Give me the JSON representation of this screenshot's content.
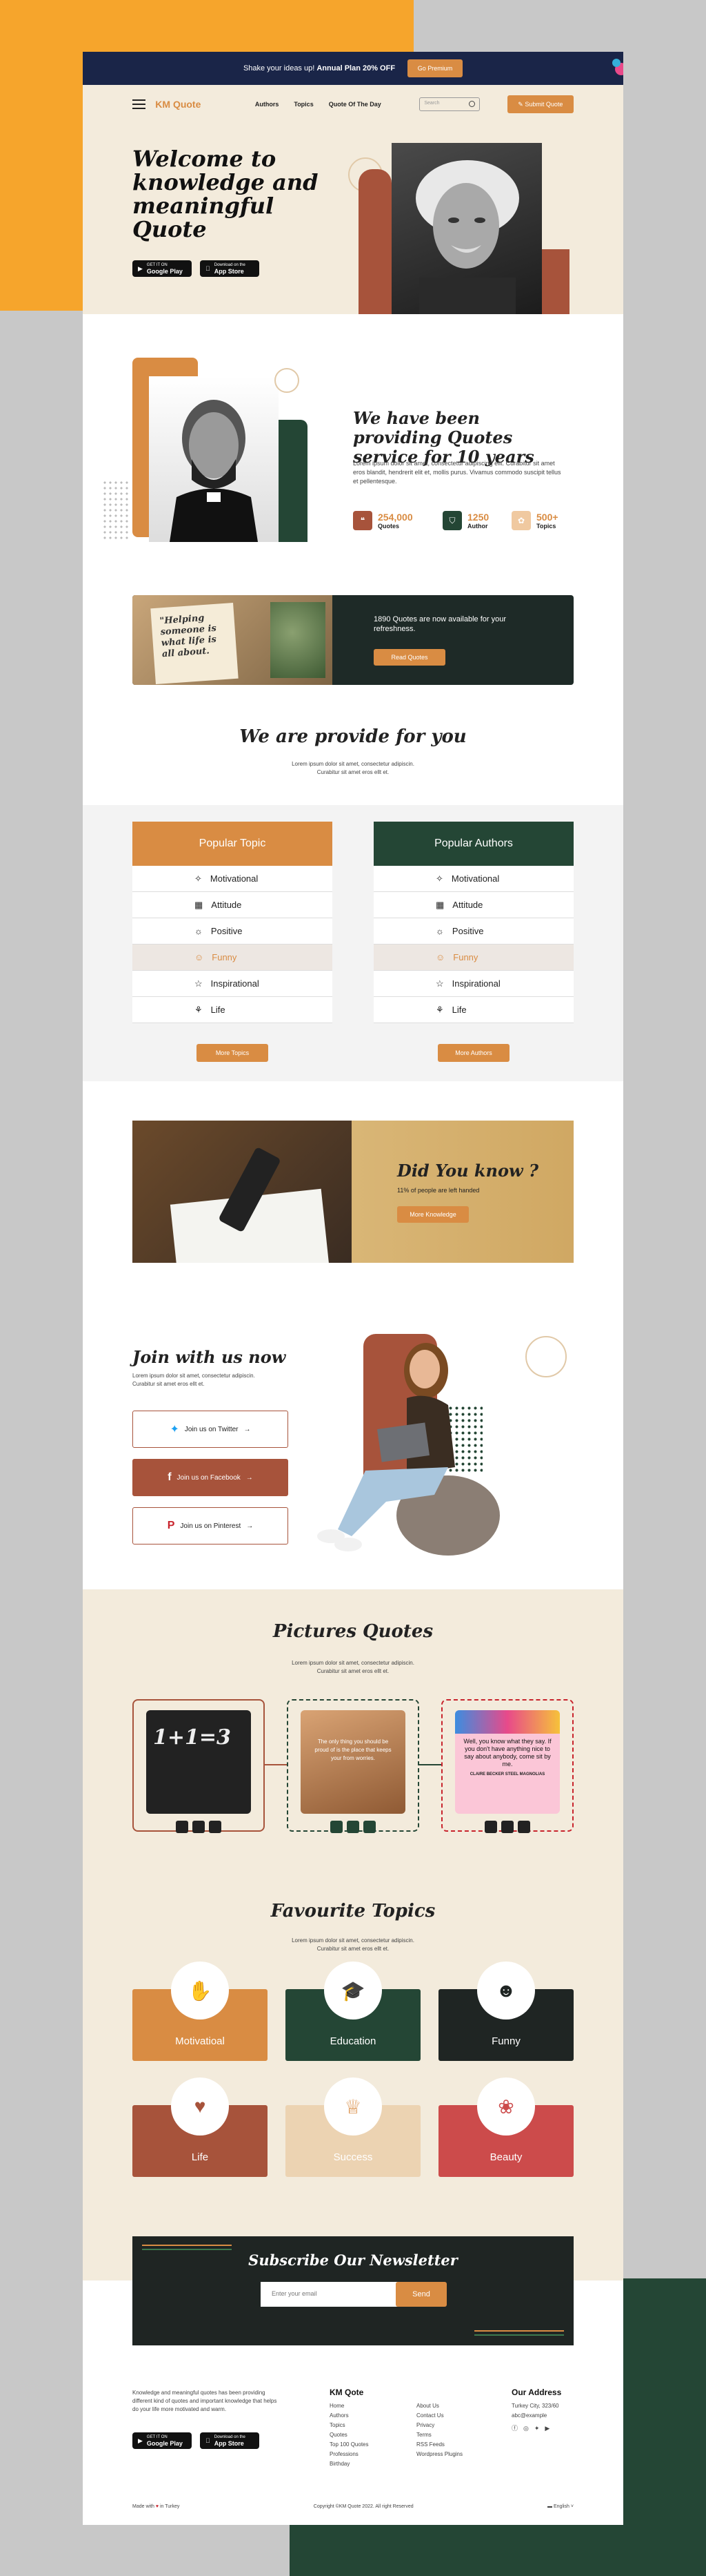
{
  "topbar": {
    "text": "Shake your ideas up!",
    "bold": "Annual Plan 20% OFF",
    "button": "Go Premium"
  },
  "nav": {
    "logo": "KM Quote",
    "links": [
      "Authors",
      "Topics",
      "Quote Of The Day"
    ],
    "search_placeholder": "Search",
    "submit": "Submit Quote"
  },
  "hero": {
    "title": "Welcome to knowledge and meaningful Quote",
    "store": [
      {
        "small": "GET IT ON",
        "label": "Google Play"
      },
      {
        "small": "Download on the",
        "label": "App Store"
      }
    ]
  },
  "providing": {
    "title": "We have been providing Quotes service for 10 years",
    "text": "Lorem ipsum dolor sit amet, consectetur adipiscing elit. Curabitur sit amet eros blandit, hendrerit elit et, mollis purus. Vivamus commodo suscipit tellus et pellentesque.",
    "stats": [
      {
        "num": "254,000",
        "label": "Quotes"
      },
      {
        "num": "1250",
        "label": "Author"
      },
      {
        "num": "500+",
        "label": "Topics"
      }
    ]
  },
  "banner": {
    "book_text": "\"Helping someone is what life is all about.",
    "text": "1890 Quotes are now available for your refreshness.",
    "button": "Read Quotes"
  },
  "provide": {
    "title": "We are provide for you",
    "sub1": "Lorem ipsum dolor sit amet, consectetur adipiscin.",
    "sub2": "Curabitur sit amet eros ellt et."
  },
  "popular_topic": {
    "title": "Popular Topic",
    "items": [
      "Motivational",
      "Attitude",
      "Positive",
      "Funny",
      "Inspirational",
      "Life"
    ],
    "button": "More Topics"
  },
  "popular_authors": {
    "title": "Popular Authors",
    "items": [
      "Motivational",
      "Attitude",
      "Positive",
      "Funny",
      "Inspirational",
      "Life"
    ],
    "button": "More Authors"
  },
  "dyk": {
    "title": "Did You know ?",
    "text": "11% of people are left handed",
    "button": "More Knowledge"
  },
  "join": {
    "title": "Join with us now",
    "sub1": "Lorem ipsum dolor sit amet, consectetur adipiscin.",
    "sub2": "Curabitur sit amet eros ellt et.",
    "twitter": "Join us on Twitter",
    "facebook": "Join us on Facebook",
    "pinterest": "Join us on Pinterest"
  },
  "pictures": {
    "title": "Pictures Quotes",
    "sub1": "Lorem ipsum dolor sit amet, consectetur adipiscin.",
    "sub2": "Curabitur sit amet eros ellt et.",
    "q2": "The only thing you should be proud of is the place that keeps your from worries.",
    "q3": "Well, you know what they say. If you don't have anything nice to say about anybody, come sit by me.",
    "q3_author": "CLAIRE BECKER STEEL MAGNOLIAS"
  },
  "favourite": {
    "title": "Favourite Topics",
    "sub1": "Lorem ipsum dolor sit amet, consectetur adipiscin.",
    "sub2": "Curabitur sit amet eros ellt et.",
    "topics": [
      "Motivatioal",
      "Education",
      "Funny",
      "Life",
      "Success",
      "Beauty"
    ]
  },
  "newsletter": {
    "title": "Subscribe Our Newsletter",
    "placeholder": "Enter your email",
    "button": "Send"
  },
  "footer": {
    "about": "Knowledge and meaningful quotes has been providing different kind of quotes and important knowledge that helps do your life more motivated and warm.",
    "col1_title": "KM Qote",
    "col1": [
      "Home",
      "Authors",
      "Topics",
      "Quotes",
      "Top 100 Quotes",
      "Professions",
      "Birthday"
    ],
    "col2": [
      "About Us",
      "Contact Us",
      "Privacy",
      "Terms",
      "RSS Feeds",
      "Wordpress Plugins"
    ],
    "col3_title": "Our Address",
    "address": "Turkey City, 323/60",
    "email": "abc@example",
    "made": "Made with",
    "made2": "in Turkey",
    "copyright": "Copyright ©KM Quote 2022. All right Reserved",
    "lang": "English"
  },
  "colors": {
    "orange": "#d98c43",
    "green": "#244635",
    "rust": "#a7533b",
    "dark": "#1f2523"
  }
}
